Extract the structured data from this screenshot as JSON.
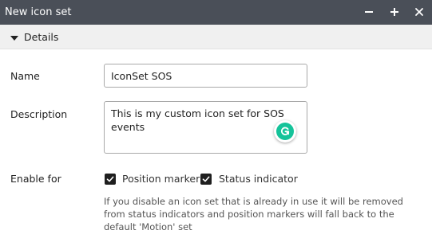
{
  "window": {
    "title": "New icon set",
    "controls": {
      "minimize_icon": "minus-icon",
      "maximize_icon": "plus-icon",
      "close_icon": "close-icon"
    }
  },
  "section": {
    "label": "Details",
    "expanded": true
  },
  "form": {
    "name": {
      "label": "Name",
      "value": "IconSet SOS"
    },
    "description": {
      "label": "Description",
      "value": "This is my custom icon set for SOS events"
    },
    "enable_for": {
      "label": "Enable for",
      "options": [
        {
          "label": "Position marker",
          "checked": true
        },
        {
          "label": "Status indicator",
          "checked": true
        }
      ],
      "help_lines": [
        "If you disable an icon set that is already in use it will be removed",
        "from status indicators and position markers will fall back to the",
        "default 'Motion' set"
      ]
    }
  },
  "colors": {
    "titlebar": "#4a4f58",
    "section_header": "#f0f0f0",
    "grammar_badge": "#15c39a"
  }
}
